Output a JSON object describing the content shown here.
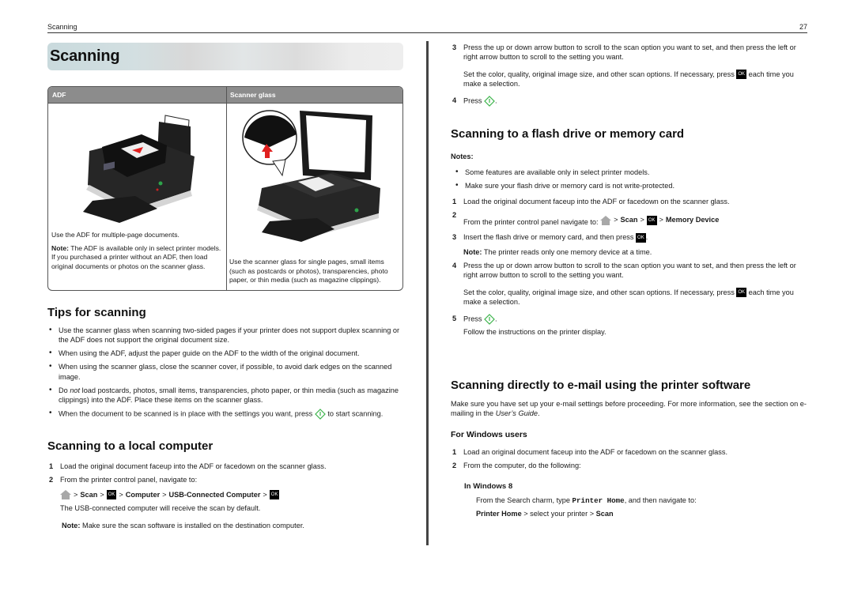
{
  "header": {
    "section": "Scanning",
    "page_number": "27"
  },
  "banner": {
    "title": "Scanning"
  },
  "table": {
    "headers": [
      "ADF",
      "Scanner glass"
    ],
    "adf": {
      "intro": "Use the ADF for multiple-page documents.",
      "note_label": "Note:",
      "note_text": " The ADF is available only in select printer models. If you purchased a printer without an ADF, then load original documents or photos on the scanner glass."
    },
    "glass": {
      "text": "Use the scanner glass for single pages, small items (such as postcards or photos), transparencies, photo paper, or thin media (such as magazine clippings)."
    }
  },
  "tips": {
    "title": "Tips for scanning",
    "items": [
      "Use the scanner glass when scanning two-sided pages if your printer does not support duplex scanning or the ADF does not support the original document size.",
      "When using the ADF, adjust the paper guide on the ADF to the width of the original document.",
      "When using the scanner glass, close the scanner cover, if possible, to avoid dark edges on the scanned image."
    ],
    "item4": {
      "pre": "Do ",
      "em": "not",
      "post": " load postcards, photos, small items, transparencies, photo paper, or thin media (such as magazine clippings) into the ADF. Place these items on the scanner glass."
    },
    "item5": {
      "pre": "When the document to be scanned is in place with the settings you want, press ",
      "post": " to start scanning."
    }
  },
  "local": {
    "title": "Scanning to a local computer",
    "step1": "Load the original document faceup into the ADF or facedown on the scanner glass.",
    "step2": "From the printer control panel, navigate to:",
    "path": {
      "sep": ">",
      "scan": "Scan",
      "ok": "OK",
      "computer": "Computer",
      "usb": "USB-Connected Computer"
    },
    "default_text": "The USB-connected computer will receive the scan by default.",
    "note_label": "Note:",
    "note_text": " Make sure the scan software is installed on the destination computer."
  },
  "right_top": {
    "step3": "Press the up or down arrow button to scroll to the scan option you want to set, and then press the left or right arrow button to scroll to the setting you want.",
    "step3_sub_pre": "Set the color, quality, original image size, and other scan options. If necessary, press ",
    "step3_sub_post": " each time you make a selection.",
    "step4_pre": "Press ",
    "step4_post": "."
  },
  "flash": {
    "title": "Scanning to a flash drive or memory card",
    "notes_label": "Notes:",
    "notes": [
      "Some features are available only in select printer models.",
      "Make sure your flash drive or memory card is not write-protected."
    ],
    "step1": "Load the original document faceup into the ADF or facedown on the scanner glass.",
    "step2": "From the printer control panel navigate to:",
    "path": {
      "scan": "Scan",
      "ok": "OK",
      "memory": "Memory Device"
    },
    "step3_pre": "Insert the flash drive or memory card, and then press ",
    "step3_post": ".",
    "note_label": "Note:",
    "note_text": " The printer reads only one memory device at a time.",
    "step4": "Press the up or down arrow button to scroll to the scan option you want to set, and then press the left or right arrow button to scroll to the setting you want.",
    "step4_sub_pre": "Set the color, quality, original image size, and other scan options. If necessary, press ",
    "step4_sub_post": " each time you make a selection.",
    "step5_pre": "Press ",
    "step5_post": ".",
    "step5_sub": "Follow the instructions on the printer display."
  },
  "email": {
    "title": "Scanning directly to e-mail using the printer software",
    "intro_pre": "Make sure you have set up your e-mail settings before proceeding. For more information, see the section on e-mailing in the ",
    "intro_em": "User’s Guide",
    "intro_post": ".",
    "windows_title": "For Windows users",
    "step1": "Load an original document faceup into the ADF or facedown on the scanner glass.",
    "step2": "From the computer, do the following:",
    "win8_title": "In Windows 8",
    "win8_pre": "From the Search charm, type ",
    "win8_mono": "Printer Home",
    "win8_post": ", and then navigate to:",
    "path": {
      "home": "Printer Home",
      "select": " > select your printer > ",
      "scan": "Scan"
    }
  },
  "colors": {
    "start_button": "#3cb44b",
    "ok_bg": "#000000",
    "table_header": "#8c8c8c"
  }
}
